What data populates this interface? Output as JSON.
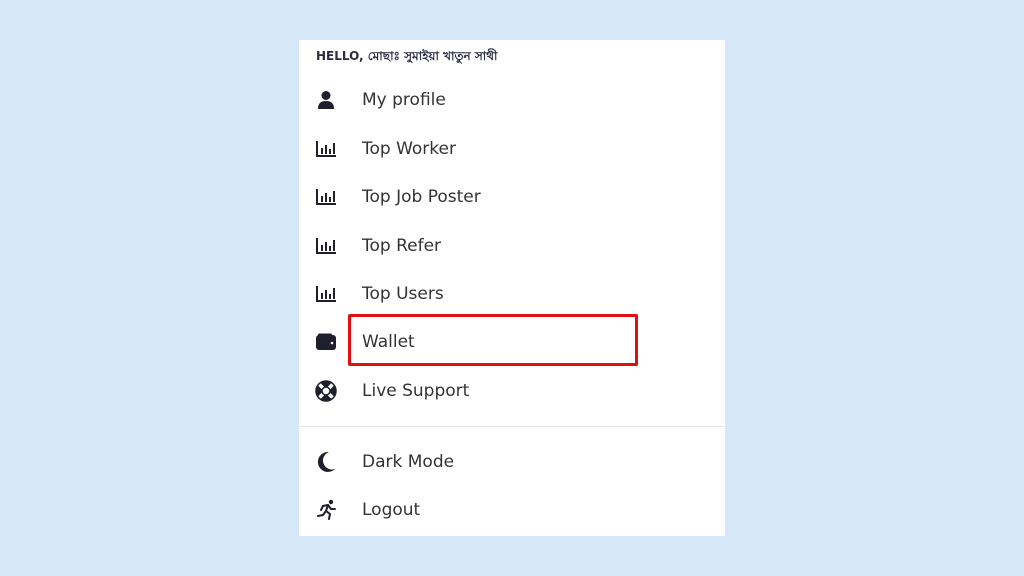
{
  "greeting": "HELLO, মোছাঃ সুমাইয়া খাতুন সাথী",
  "menu": {
    "items": [
      {
        "label": "My profile",
        "icon": "user-icon"
      },
      {
        "label": "Top Worker",
        "icon": "bar-chart-icon"
      },
      {
        "label": "Top Job Poster",
        "icon": "bar-chart-icon"
      },
      {
        "label": "Top Refer",
        "icon": "bar-chart-icon"
      },
      {
        "label": "Top Users",
        "icon": "bar-chart-icon"
      },
      {
        "label": "Wallet",
        "icon": "wallet-icon"
      },
      {
        "label": "Live Support",
        "icon": "life-ring-icon"
      }
    ],
    "footer_items": [
      {
        "label": "Dark Mode",
        "icon": "moon-icon"
      },
      {
        "label": "Logout",
        "icon": "running-person-icon"
      }
    ]
  },
  "highlighted_item": "Wallet",
  "colors": {
    "background": "#d6e8f8",
    "panel": "#ffffff",
    "highlight_border": "#e01010",
    "text": "#333333",
    "icon": "#1f1f2e"
  }
}
